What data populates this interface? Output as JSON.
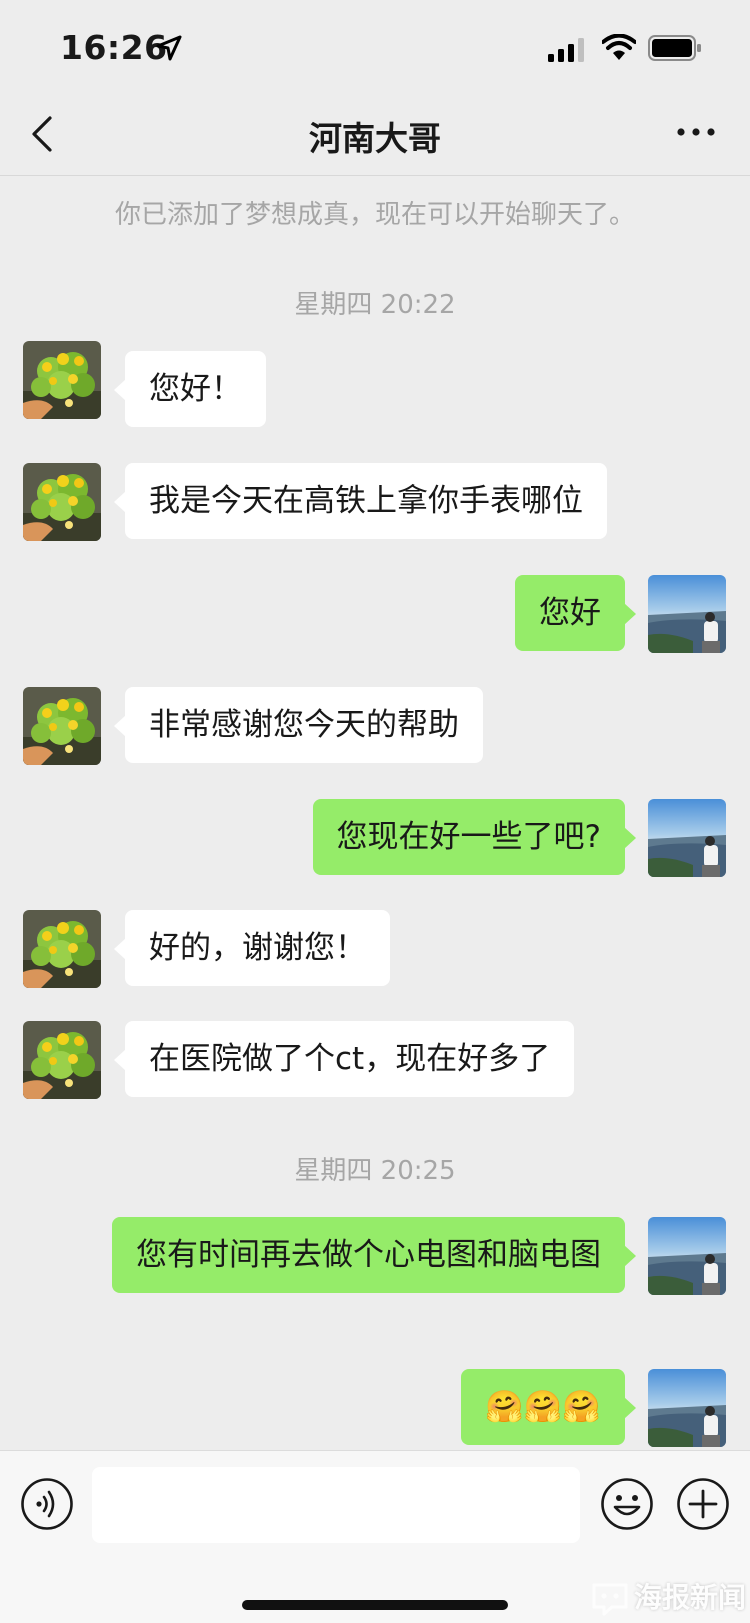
{
  "status_bar": {
    "time": "16:26"
  },
  "nav": {
    "title": "河南大哥"
  },
  "system_notice": "你已添加了梦想成真，现在可以开始聊天了。",
  "timestamps": [
    "星期四 20:22",
    "星期四 20:25"
  ],
  "messages": [
    {
      "side": "left",
      "text": "您好！"
    },
    {
      "side": "left",
      "text": "我是今天在高铁上拿你手表哪位"
    },
    {
      "side": "right",
      "text": "您好"
    },
    {
      "side": "left",
      "text": "非常感谢您今天的帮助"
    },
    {
      "side": "right",
      "text": "您现在好一些了吧?"
    },
    {
      "side": "left",
      "text": "好的，谢谢您！"
    },
    {
      "side": "left",
      "text": "在医院做了个ct，现在好多了"
    },
    {
      "side": "right",
      "text": "您有时间再去做个心电图和脑电图"
    },
    {
      "side": "right",
      "text": "🤗🤗🤗"
    }
  ],
  "input": {
    "placeholder": ""
  },
  "watermark": "海报新闻",
  "colors": {
    "sent_bubble": "#95ec69",
    "received_bubble": "#ffffff",
    "background": "#ededed"
  }
}
